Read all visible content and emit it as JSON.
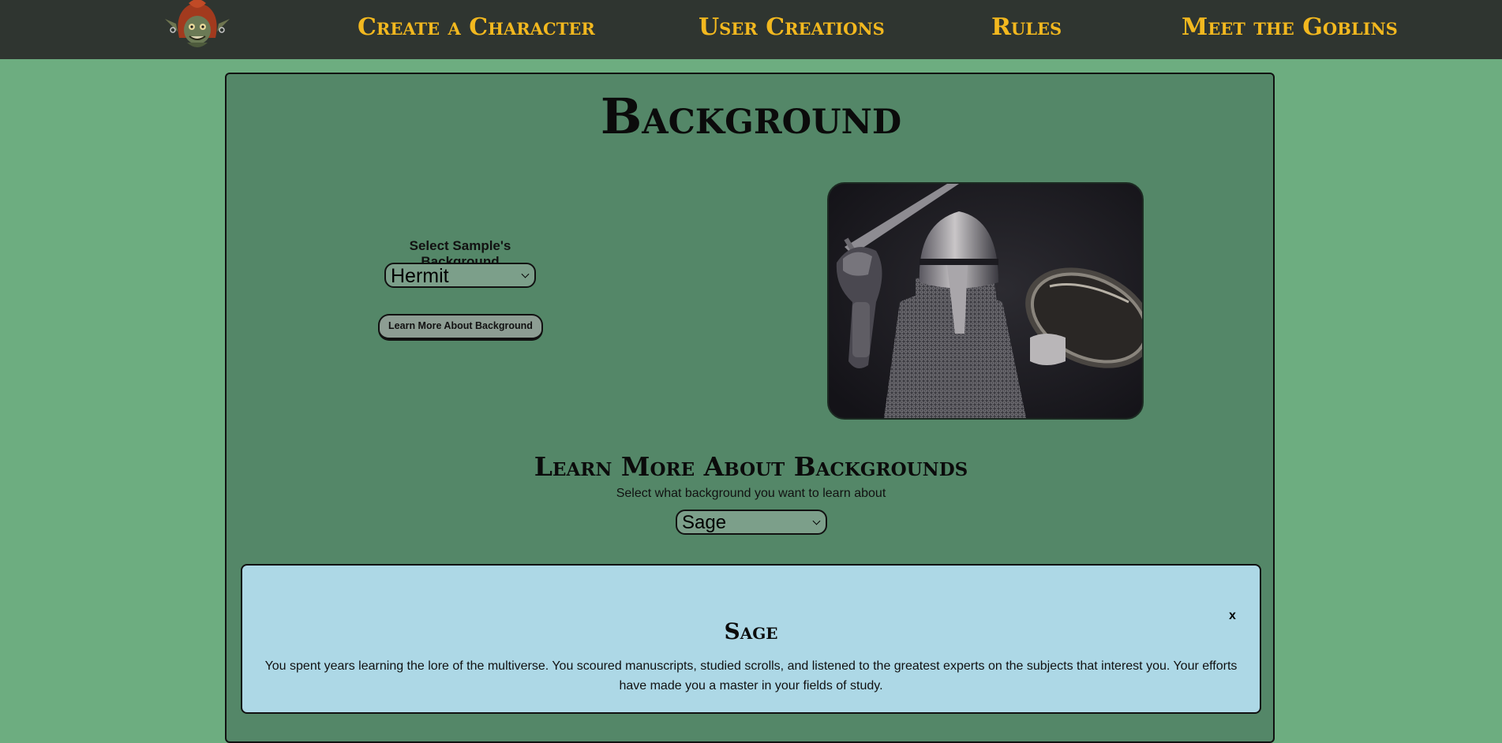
{
  "nav": {
    "logo_icon": "goblin-head-icon",
    "items": [
      {
        "label": "Create a Character"
      },
      {
        "label": "User Creations"
      },
      {
        "label": "Rules"
      },
      {
        "label": "Meet the Goblins"
      }
    ]
  },
  "page": {
    "title": "Background"
  },
  "sample": {
    "label": "Select Sample's Background",
    "selected": "Hermit",
    "button_label": "Learn More About Background",
    "image_icon": "armored-knight-with-sword-and-shield-photo"
  },
  "learn": {
    "title": "Learn More About Backgrounds",
    "subtitle": "Select what background you want to learn about",
    "selected": "Sage"
  },
  "card": {
    "close_label": "x",
    "title": "Sage",
    "text": "You spent years learning the lore of the multiverse. You scoured manuscripts, studied scrolls, and listened to the greatest experts on the subjects that interest you. Your efforts have made you a master in your fields of study."
  },
  "colors": {
    "page_bg": "#6dad80",
    "nav_bg": "#2f3530",
    "nav_text": "#f2b81f",
    "panel_bg": "#548768",
    "card_bg": "#add8e6",
    "select_bg": "#7c9f8a",
    "button_bg": "#8d9d93"
  }
}
